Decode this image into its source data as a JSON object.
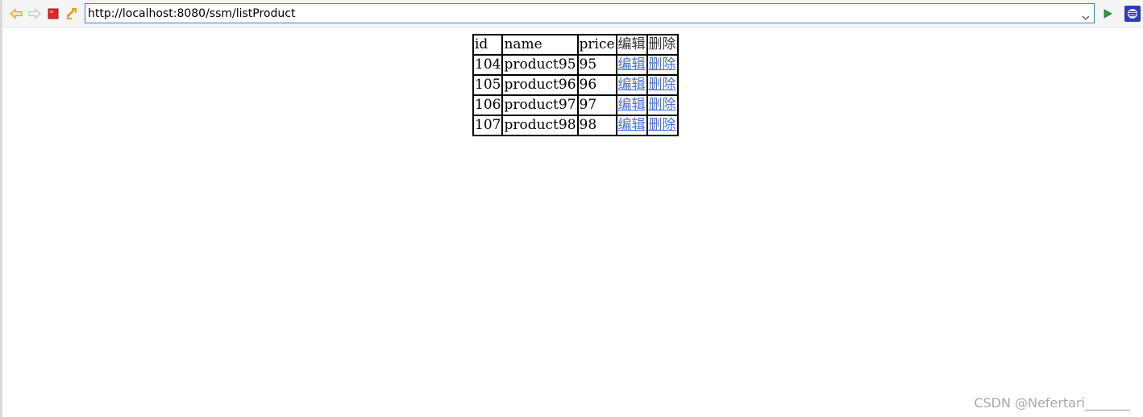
{
  "toolbar": {
    "back_icon": "back-arrow-icon",
    "forward_icon": "forward-arrow-icon",
    "stop_icon": "stop-icon",
    "refresh_icon": "refresh-icon",
    "go_icon": "go-icon",
    "app_icon": "eclipse-icon",
    "url": "http://localhost:8080/ssm/listProduct"
  },
  "table": {
    "headers": [
      "id",
      "name",
      "price",
      "编辑",
      "删除"
    ],
    "rows": [
      {
        "id": "104",
        "name": "product95",
        "price": "95",
        "edit": "编辑",
        "delete": "删除"
      },
      {
        "id": "105",
        "name": "product96",
        "price": "96",
        "edit": "编辑",
        "delete": "删除"
      },
      {
        "id": "106",
        "name": "product97",
        "price": "97",
        "edit": "编辑",
        "delete": "删除"
      },
      {
        "id": "107",
        "name": "product98",
        "price": "98",
        "edit": "编辑",
        "delete": "删除"
      }
    ]
  },
  "watermark": "CSDN @Nefertari_______",
  "colors": {
    "link": "#4a6fd8",
    "url_border": "#3b7fd1",
    "stop": "#e32626",
    "nav_arrow": "#e8a020",
    "go": "#2d9c3a"
  }
}
